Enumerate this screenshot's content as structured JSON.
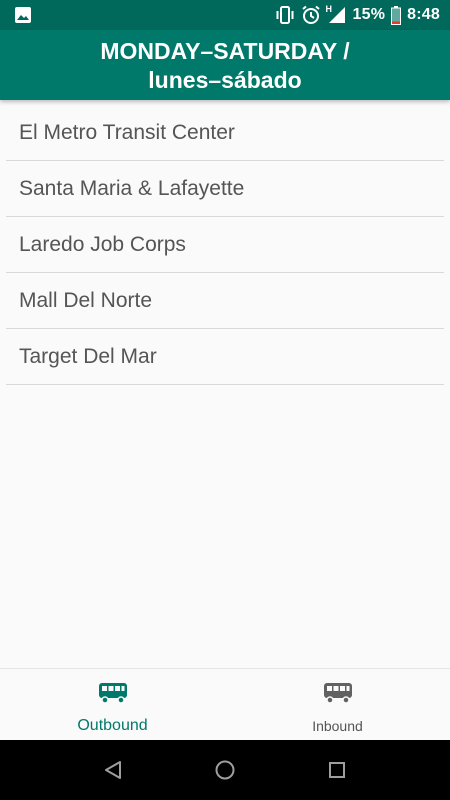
{
  "status_bar": {
    "gallery_icon": "image-icon",
    "vibrate_icon": "vibrate-icon",
    "alarm_icon": "alarm-icon",
    "network_type": "H",
    "battery_percent": "15%",
    "time": "8:48"
  },
  "app_bar": {
    "title": "MONDAY–SATURDAY /\nlunes–sábado",
    "background": "#00796b",
    "status_background": "#00695c"
  },
  "stops": [
    {
      "label": "El Metro Transit Center"
    },
    {
      "label": "Santa Maria & Lafayette"
    },
    {
      "label": "Laredo Job Corps"
    },
    {
      "label": "Mall Del Norte"
    },
    {
      "label": "Target Del Mar"
    }
  ],
  "bottom_nav": {
    "items": [
      {
        "label": "Outbound",
        "icon": "bus-icon",
        "active": true,
        "color": "#00796b"
      },
      {
        "label": "Inbound",
        "icon": "bus-icon",
        "active": false,
        "color": "#555555"
      }
    ]
  },
  "system_nav": {
    "back_icon": "back-triangle-icon",
    "home_icon": "home-circle-icon",
    "recents_icon": "recents-square-icon"
  }
}
